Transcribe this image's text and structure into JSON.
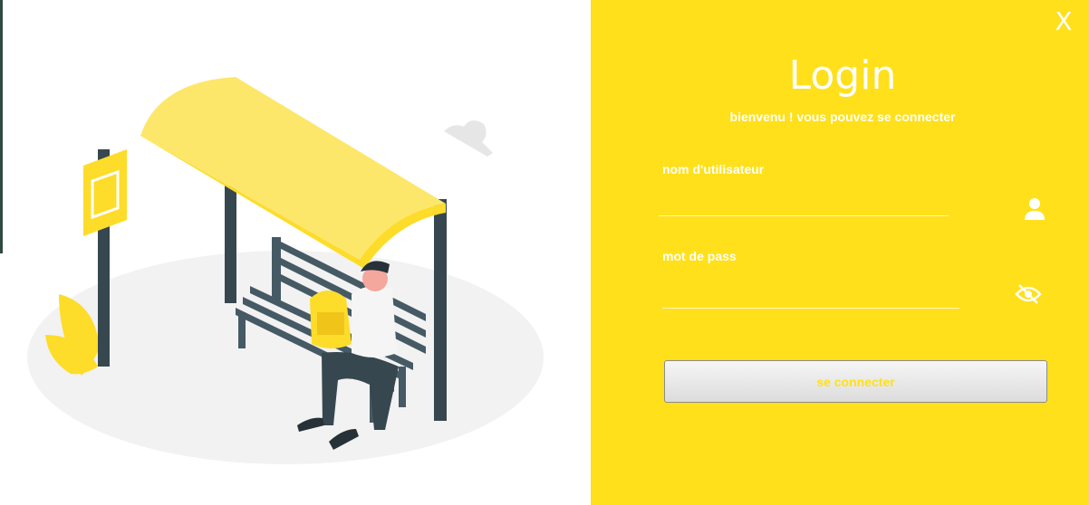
{
  "window": {
    "close_label": "X"
  },
  "login": {
    "title": "Login",
    "subtitle": "bienvenu ! vous pouvez se connecter",
    "username_label": "nom d'utilisateur",
    "username_value": "",
    "username_icon": "user-icon",
    "password_label": "mot de pass",
    "password_value": "",
    "password_icon": "eye-slash-icon",
    "submit_label": "se connecter"
  },
  "theme": {
    "accent": "#ffe01b",
    "text_on_accent": "#ffffff",
    "illustration_yellow": "#fddc2a",
    "illustration_dark": "#37474f"
  }
}
